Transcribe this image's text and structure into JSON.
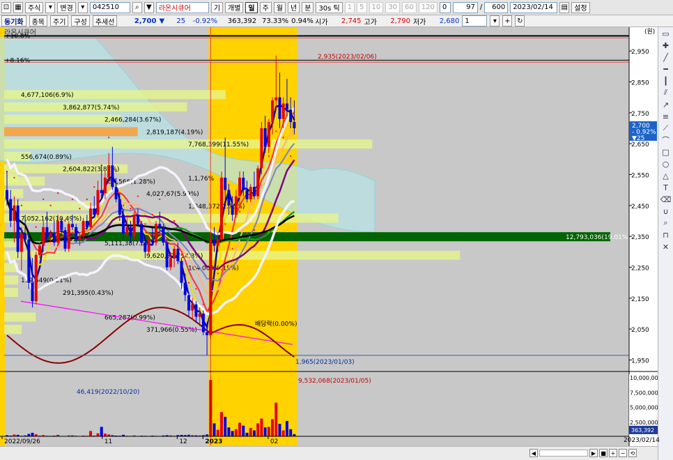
{
  "toolbar": {
    "market_type": "주식",
    "modify_label": "변경",
    "stock_code": "042510",
    "stock_name": "라온시큐어",
    "btn_gi": "기",
    "btn_gaebyeol": "개별",
    "btn_il": "일",
    "btn_ju": "주",
    "btn_wol": "월",
    "btn_nyeon": "년",
    "btn_bun": "분",
    "btn_tick": "30s 틱",
    "periods": [
      "1",
      "5",
      "10",
      "30",
      "60",
      "120"
    ],
    "period_count": "0",
    "view_count": "97",
    "total_count": "600",
    "date": "2023/02/14",
    "settings_label": "설정"
  },
  "toolbar2": {
    "chart_tab": "동기화",
    "item_tab": "종목",
    "cycle_label": "주기",
    "compose_label": "구성",
    "indicator_label": "추세선",
    "price": "2,700",
    "change_arrow": "▼",
    "change": "25",
    "change_pct": "-0.92%",
    "volume": "363,392",
    "turnover": "73.33%",
    "ratio": "0.94%",
    "open_label": "시가",
    "open": "2,745",
    "high_label": "고가",
    "high": "2,790",
    "low_label": "저가",
    "low": "2,680",
    "select_value": "1"
  },
  "chart_title": "라온시큐어",
  "unit_label": "(원)",
  "colors": {
    "chart_bg": "#c8c8c8",
    "highlight": "#ffd200",
    "up": "#e60000",
    "down": "#0000e6",
    "price_tag_bg": "#1e64c8",
    "vol_tag_bg": "#1e3c9a"
  },
  "chart_data": {
    "type": "candlestick",
    "title": "라온시큐어",
    "x_ticks": [
      "2022/09/26",
      "11",
      "12",
      "2023",
      "02"
    ],
    "y_ticks": [
      "2,950",
      "2,850",
      "2,750",
      "2,650",
      "2,550",
      "2,450",
      "2,350",
      "2,250",
      "2,150",
      "2,050",
      "1,950"
    ],
    "ylim": [
      1915,
      3000
    ],
    "volume_ticks": [
      "10,000,000",
      "7,500,000",
      "5,000,000",
      "2,500,000"
    ],
    "volume_max": 10500000,
    "current_price": {
      "label": "2,700",
      "change": "- 0.92%",
      "sub": "▼25"
    },
    "current_volume": "363,392",
    "horizontal_levels": [
      {
        "label": "2,999",
        "value": 2999
      },
      {
        "label": "2,920",
        "value": 2920
      }
    ],
    "top_left_labels": [
      "+10.8%",
      "+8.16%"
    ],
    "annotations": [
      {
        "label": "2,935(2023/02/06)"
      },
      {
        "label": "9,532,068(2023/01/05)"
      },
      {
        "label": "1,965(2023/01/03)"
      },
      {
        "label": "46,419(2022/10/20)"
      },
      {
        "label": "배당락(0.00%)"
      }
    ],
    "volume_profile": [
      {
        "label": "4,677,106(6.9%)",
        "price": 2810
      },
      {
        "label": "3,862,877(5.74%)",
        "price": 2770
      },
      {
        "label": "2,466,284(3.67%)",
        "price": 2730
      },
      {
        "label": "2,819,187(4.19%)",
        "price": 2690
      },
      {
        "label": "7,768,399(11.55%)",
        "price": 2650
      },
      {
        "label": "556,674(0.89%)",
        "price": 2610
      },
      {
        "label": "2,604,822(3.87%)",
        "price": 2570
      },
      {
        "label": "856,566(1.28%)",
        "price": 2530
      },
      {
        "label": "4,027,67(5.99%)",
        "price": 2490
      },
      {
        "label": "1,848,372(2.75%)",
        "price": 2450
      },
      {
        "label": "7,052,162(10.49%)",
        "price": 2410
      },
      {
        "label": "12,793,036(19.01%)",
        "price": 2350
      },
      {
        "label": "5,111,38(7.6%)",
        "price": 2330
      },
      {
        "label": "9,620,528(14.3%)",
        "price": 2290
      },
      {
        "label": "104,000(0.15%)",
        "price": 2250
      },
      {
        "label": "139,649(0.21%)",
        "price": 2210
      },
      {
        "label": "291,395(0.43%)",
        "price": 2170
      },
      {
        "label": "665,287(0.99%)",
        "price": 2090
      },
      {
        "label": "371,966(0.55%)",
        "price": 2050
      },
      {
        "label": "1,1,76%",
        "price": 2540
      }
    ],
    "candles": [
      {
        "o": 2500,
        "h": 2560,
        "l": 2450,
        "c": 2470
      },
      {
        "o": 2470,
        "h": 2500,
        "l": 2380,
        "c": 2400
      },
      {
        "o": 2400,
        "h": 2480,
        "l": 2330,
        "c": 2450
      },
      {
        "o": 2450,
        "h": 2470,
        "l": 2280,
        "c": 2300
      },
      {
        "o": 2300,
        "h": 2380,
        "l": 2240,
        "c": 2360
      },
      {
        "o": 2360,
        "h": 2420,
        "l": 2330,
        "c": 2340
      },
      {
        "o": 2340,
        "h": 2360,
        "l": 2180,
        "c": 2200
      },
      {
        "o": 2200,
        "h": 2280,
        "l": 2120,
        "c": 2140
      },
      {
        "o": 2140,
        "h": 2300,
        "l": 2130,
        "c": 2290
      },
      {
        "o": 2290,
        "h": 2330,
        "l": 2280,
        "c": 2320
      },
      {
        "o": 2320,
        "h": 2400,
        "l": 2300,
        "c": 2380
      },
      {
        "o": 2380,
        "h": 2430,
        "l": 2330,
        "c": 2350
      },
      {
        "o": 2350,
        "h": 2370,
        "l": 2330,
        "c": 2360
      },
      {
        "o": 2360,
        "h": 2400,
        "l": 2320,
        "c": 2330
      },
      {
        "o": 2330,
        "h": 2420,
        "l": 2320,
        "c": 2400
      },
      {
        "o": 2400,
        "h": 2410,
        "l": 2350,
        "c": 2370
      },
      {
        "o": 2370,
        "h": 2380,
        "l": 2300,
        "c": 2310
      },
      {
        "o": 2310,
        "h": 2400,
        "l": 2300,
        "c": 2390
      },
      {
        "o": 2390,
        "h": 2420,
        "l": 2370,
        "c": 2380
      },
      {
        "o": 2380,
        "h": 2390,
        "l": 2330,
        "c": 2340
      },
      {
        "o": 2340,
        "h": 2360,
        "l": 2320,
        "c": 2350
      },
      {
        "o": 2350,
        "h": 2410,
        "l": 2340,
        "c": 2400
      },
      {
        "o": 2400,
        "h": 2420,
        "l": 2370,
        "c": 2380
      },
      {
        "o": 2380,
        "h": 2460,
        "l": 2370,
        "c": 2440
      },
      {
        "o": 2440,
        "h": 2480,
        "l": 2410,
        "c": 2420
      },
      {
        "o": 2420,
        "h": 2530,
        "l": 2410,
        "c": 2500
      },
      {
        "o": 2500,
        "h": 2580,
        "l": 2470,
        "c": 2490
      },
      {
        "o": 2490,
        "h": 2560,
        "l": 2470,
        "c": 2540
      },
      {
        "o": 2540,
        "h": 2620,
        "l": 2520,
        "c": 2580
      },
      {
        "o": 2580,
        "h": 2640,
        "l": 2500,
        "c": 2510
      },
      {
        "o": 2510,
        "h": 2540,
        "l": 2460,
        "c": 2470
      },
      {
        "o": 2470,
        "h": 2490,
        "l": 2400,
        "c": 2420
      },
      {
        "o": 2420,
        "h": 2440,
        "l": 2340,
        "c": 2360
      },
      {
        "o": 2360,
        "h": 2410,
        "l": 2350,
        "c": 2380
      },
      {
        "o": 2380,
        "h": 2400,
        "l": 2330,
        "c": 2350
      },
      {
        "o": 2350,
        "h": 2430,
        "l": 2340,
        "c": 2420
      },
      {
        "o": 2420,
        "h": 2440,
        "l": 2380,
        "c": 2390
      },
      {
        "o": 2390,
        "h": 2400,
        "l": 2320,
        "c": 2330
      },
      {
        "o": 2330,
        "h": 2340,
        "l": 2280,
        "c": 2300
      },
      {
        "o": 2300,
        "h": 2350,
        "l": 2290,
        "c": 2340
      },
      {
        "o": 2340,
        "h": 2380,
        "l": 2320,
        "c": 2330
      },
      {
        "o": 2330,
        "h": 2400,
        "l": 2320,
        "c": 2390
      },
      {
        "o": 2390,
        "h": 2430,
        "l": 2360,
        "c": 2380
      },
      {
        "o": 2380,
        "h": 2390,
        "l": 2320,
        "c": 2330
      },
      {
        "o": 2330,
        "h": 2340,
        "l": 2240,
        "c": 2250
      },
      {
        "o": 2250,
        "h": 2300,
        "l": 2240,
        "c": 2280
      },
      {
        "o": 2280,
        "h": 2320,
        "l": 2250,
        "c": 2310
      },
      {
        "o": 2310,
        "h": 2330,
        "l": 2260,
        "c": 2270
      },
      {
        "o": 2270,
        "h": 2280,
        "l": 2180,
        "c": 2200
      },
      {
        "o": 2200,
        "h": 2230,
        "l": 2140,
        "c": 2160
      },
      {
        "o": 2160,
        "h": 2170,
        "l": 2090,
        "c": 2110
      },
      {
        "o": 2110,
        "h": 2150,
        "l": 2080,
        "c": 2130
      },
      {
        "o": 2130,
        "h": 2140,
        "l": 2070,
        "c": 2090
      },
      {
        "o": 2090,
        "h": 2120,
        "l": 2060,
        "c": 2100
      },
      {
        "o": 2100,
        "h": 2110,
        "l": 2030,
        "c": 2040
      },
      {
        "o": 2040,
        "h": 2060,
        "l": 1965,
        "c": 2030
      },
      {
        "o": 2030,
        "h": 2360,
        "l": 2020,
        "c": 2340
      },
      {
        "o": 2340,
        "h": 2380,
        "l": 2300,
        "c": 2320
      },
      {
        "o": 2320,
        "h": 2360,
        "l": 2300,
        "c": 2340
      },
      {
        "o": 2340,
        "h": 2560,
        "l": 2330,
        "c": 2540
      },
      {
        "o": 2540,
        "h": 2670,
        "l": 2460,
        "c": 2500
      },
      {
        "o": 2500,
        "h": 2520,
        "l": 2420,
        "c": 2450
      },
      {
        "o": 2450,
        "h": 2480,
        "l": 2400,
        "c": 2420
      },
      {
        "o": 2420,
        "h": 2500,
        "l": 2410,
        "c": 2480
      },
      {
        "o": 2480,
        "h": 2560,
        "l": 2450,
        "c": 2540
      },
      {
        "o": 2540,
        "h": 2560,
        "l": 2480,
        "c": 2500
      },
      {
        "o": 2500,
        "h": 2530,
        "l": 2460,
        "c": 2470
      },
      {
        "o": 2470,
        "h": 2520,
        "l": 2460,
        "c": 2510
      },
      {
        "o": 2510,
        "h": 2560,
        "l": 2470,
        "c": 2480
      },
      {
        "o": 2480,
        "h": 2580,
        "l": 2470,
        "c": 2570
      },
      {
        "o": 2570,
        "h": 2720,
        "l": 2550,
        "c": 2700
      },
      {
        "o": 2700,
        "h": 2740,
        "l": 2620,
        "c": 2640
      },
      {
        "o": 2640,
        "h": 2730,
        "l": 2620,
        "c": 2720
      },
      {
        "o": 2720,
        "h": 2800,
        "l": 2680,
        "c": 2790
      },
      {
        "o": 2790,
        "h": 2935,
        "l": 2760,
        "c": 2800
      },
      {
        "o": 2800,
        "h": 2880,
        "l": 2700,
        "c": 2730
      },
      {
        "o": 2730,
        "h": 2800,
        "l": 2700,
        "c": 2780
      },
      {
        "o": 2780,
        "h": 2860,
        "l": 2740,
        "c": 2760
      },
      {
        "o": 2760,
        "h": 2800,
        "l": 2700,
        "c": 2720
      },
      {
        "o": 2720,
        "h": 2790,
        "l": 2680,
        "c": 2700
      }
    ],
    "volumes": [
      180000,
      120000,
      300000,
      250000,
      90000,
      140000,
      400000,
      600000,
      350000,
      120000,
      200000,
      90000,
      80000,
      110000,
      250000,
      70000,
      60000,
      150000,
      140000,
      90000,
      60000,
      120000,
      80000,
      900000,
      110000,
      500000,
      1600000,
      450000,
      320000,
      180000,
      120000,
      100000,
      260000,
      90000,
      70000,
      150000,
      60000,
      110000,
      90000,
      70000,
      120000,
      80000,
      60000,
      140000,
      190000,
      150000,
      90000,
      200000,
      240000,
      210000,
      260000,
      180000,
      160000,
      150000,
      190000,
      320000,
      9532068,
      2200000,
      1100000,
      4100000,
      3300000,
      1500000,
      900000,
      1200000,
      2300000,
      1800000,
      600000,
      1400000,
      1000000,
      2200000,
      3000000,
      1500000,
      1600000,
      2900000,
      5700000,
      2100000,
      1000000,
      2600000,
      1200000,
      363392
    ]
  }
}
